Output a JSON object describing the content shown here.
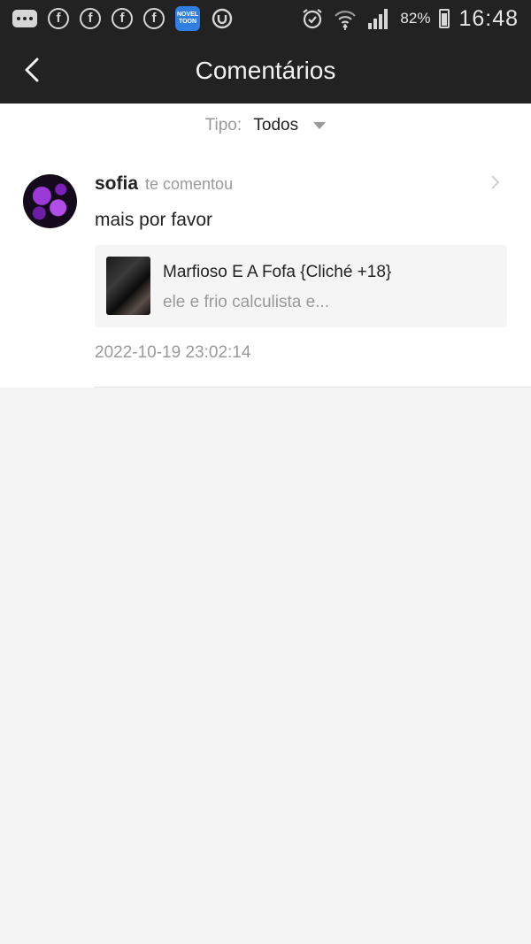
{
  "status_bar": {
    "left_icons": [
      "message-icon",
      "facebook-icon",
      "facebook-icon",
      "facebook-icon",
      "facebook-icon",
      "noveltoon-icon",
      "sync-icon"
    ],
    "noveltoon_label": "NOVEL TOON",
    "facebook_glyph": "f",
    "battery_percent": "82%",
    "battery_level": 0.82,
    "time": "16:48"
  },
  "header": {
    "title": "Comentários",
    "back_icon": "back-arrow-icon"
  },
  "filter": {
    "label": "Tipo:",
    "value": "Todos"
  },
  "notifications": [
    {
      "user_name": "sofia",
      "action": "te comentou",
      "comment": "mais por favor",
      "book_title": "Marfioso E A Fofa {Cliché +18}",
      "book_description": "ele e frio calculista e...",
      "timestamp": "2022-10-19 23:02:14"
    }
  ],
  "colors": {
    "bar_background": "#222222",
    "page_background": "#f3f3f4",
    "card_background": "#f5f5f5",
    "muted_text": "#9a9a9a",
    "primary_text": "#222222"
  }
}
